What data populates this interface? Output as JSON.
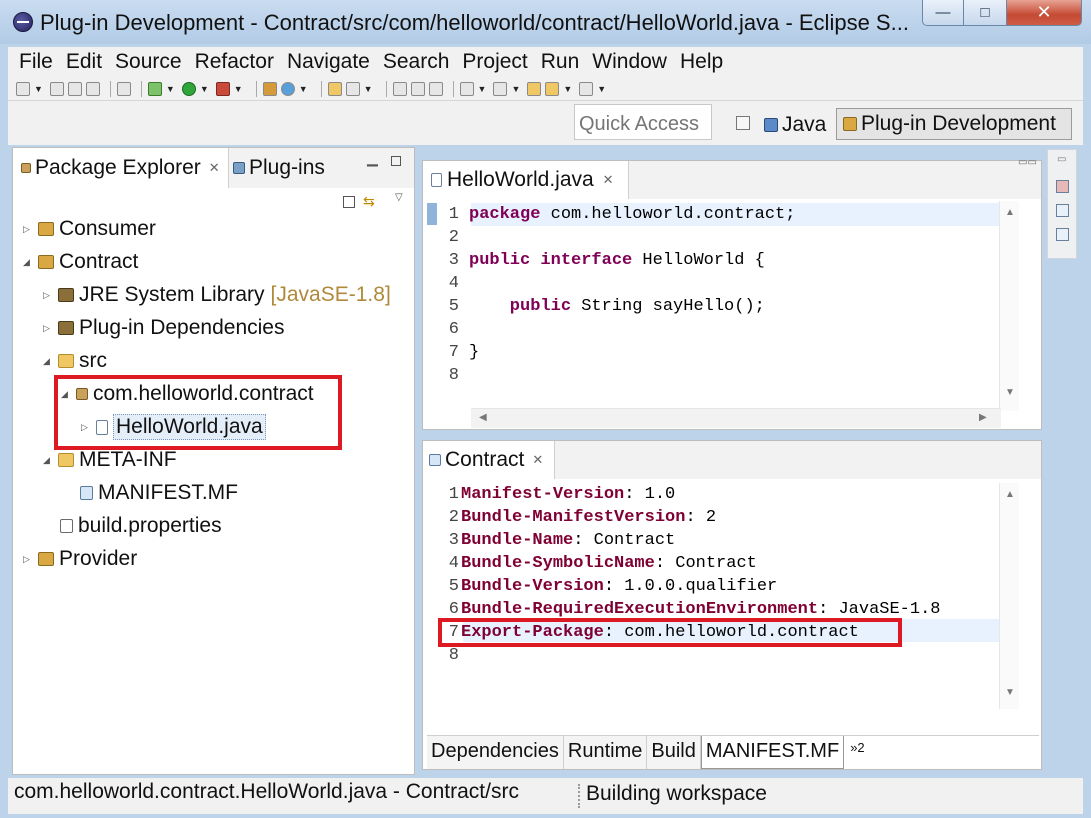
{
  "window": {
    "title": "Plug-in Development - Contract/src/com/helloworld/contract/HelloWorld.java - Eclipse S...",
    "controls": {
      "minimize": "—",
      "maximize": "□",
      "close": "✕"
    }
  },
  "menu": [
    "File",
    "Edit",
    "Source",
    "Refactor",
    "Navigate",
    "Search",
    "Project",
    "Run",
    "Window",
    "Help"
  ],
  "perspective_bar": {
    "quick_access_placeholder": "Quick Access",
    "java": "Java",
    "plugin_development": "Plug-in Development"
  },
  "left_panel": {
    "tabs": [
      "Package Explorer",
      "Plug-ins"
    ],
    "tree": [
      {
        "label": "Consumer",
        "decor": ""
      },
      {
        "label": "Contract",
        "decor": ""
      },
      {
        "label": "JRE System Library",
        "decor": "[JavaSE-1.8]"
      },
      {
        "label": "Plug-in Dependencies",
        "decor": ""
      },
      {
        "label": "src",
        "decor": ""
      },
      {
        "label": "com.helloworld.contract",
        "decor": ""
      },
      {
        "label": "HelloWorld.java",
        "decor": ""
      },
      {
        "label": "META-INF",
        "decor": ""
      },
      {
        "label": "MANIFEST.MF",
        "decor": ""
      },
      {
        "label": "build.properties",
        "decor": ""
      },
      {
        "label": "Provider",
        "decor": ""
      }
    ]
  },
  "java_editor": {
    "tab": "HelloWorld.java",
    "lines": [
      {
        "num": "1",
        "kw": "package",
        "text": " com.helloworld.contract;"
      },
      {
        "num": "2",
        "kw": "",
        "text": ""
      },
      {
        "num": "3",
        "kw": "public interface",
        "text": " HelloWorld {"
      },
      {
        "num": "4",
        "kw": "",
        "text": ""
      },
      {
        "num": "5",
        "kw": "    public",
        "text": " String sayHello();"
      },
      {
        "num": "6",
        "kw": "",
        "text": ""
      },
      {
        "num": "7",
        "kw": "",
        "text": "}"
      },
      {
        "num": "8",
        "kw": "",
        "text": ""
      }
    ]
  },
  "manifest_editor": {
    "tab": "Contract",
    "lines": [
      {
        "num": "1",
        "key": "Manifest-Version",
        "value": ": 1.0"
      },
      {
        "num": "2",
        "key": "Bundle-ManifestVersion",
        "value": ": 2"
      },
      {
        "num": "3",
        "key": "Bundle-Name",
        "value": ": Contract"
      },
      {
        "num": "4",
        "key": "Bundle-SymbolicName",
        "value": ": Contract"
      },
      {
        "num": "5",
        "key": "Bundle-Version",
        "value": ": 1.0.0.qualifier"
      },
      {
        "num": "6",
        "key": "Bundle-RequiredExecutionEnvironment",
        "value": ": JavaSE-1.8"
      },
      {
        "num": "7",
        "key": "Export-Package",
        "value": ": com.helloworld.contract"
      },
      {
        "num": "8",
        "key": "",
        "value": ""
      }
    ],
    "bottom_tabs": [
      "Dependencies",
      "Runtime",
      "Build",
      "MANIFEST.MF"
    ],
    "more_tabs": "»2"
  },
  "status": {
    "left": "com.helloworld.contract.HelloWorld.java - Contract/src",
    "right": "Building workspace"
  },
  "colors": {
    "keyword": "#7f0055",
    "highlight_box": "#dd1a22",
    "window_frame": "#bcd3ea"
  }
}
